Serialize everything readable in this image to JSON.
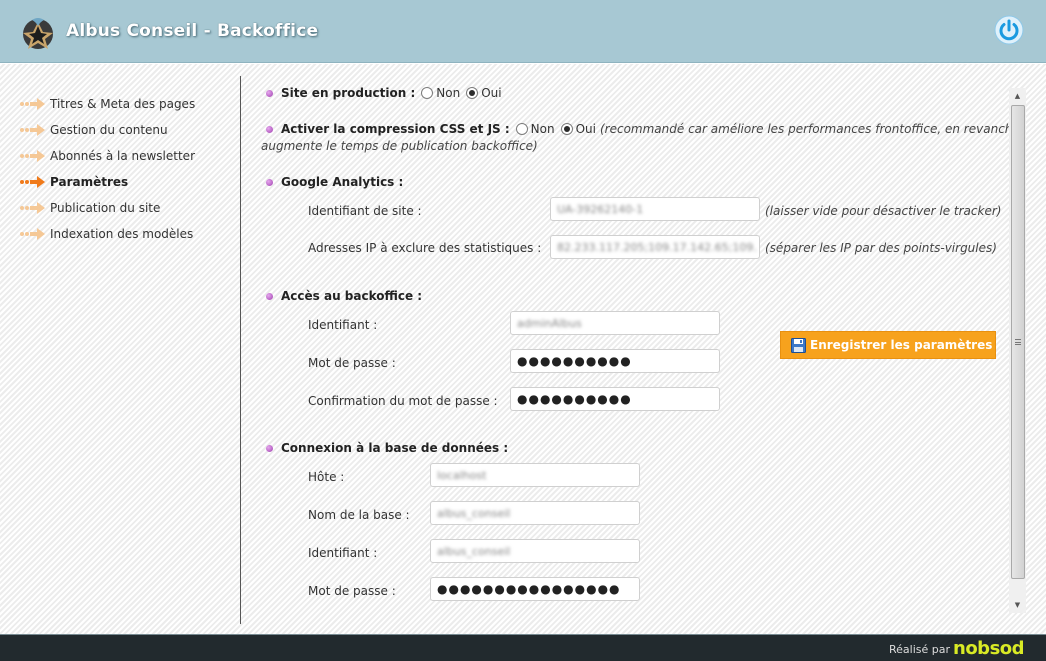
{
  "header": {
    "title": "Albus Conseil - Backoffice",
    "logo_icon": "albus-logo-icon",
    "power_icon": "power-icon"
  },
  "sidebar": {
    "items": [
      {
        "label": "Titres & Meta des pages",
        "active": false
      },
      {
        "label": "Gestion du contenu",
        "active": false
      },
      {
        "label": "Abonnés à la newsletter",
        "active": false
      },
      {
        "label": "Paramètres",
        "active": true
      },
      {
        "label": "Publication du site",
        "active": false
      },
      {
        "label": "Indexation des modèles",
        "active": false
      }
    ]
  },
  "main": {
    "production": {
      "title": "Site en production :",
      "opt_no": "Non",
      "opt_yes": "Oui",
      "selected": "Oui"
    },
    "compression": {
      "title": "Activer la compression CSS et JS :",
      "opt_no": "Non",
      "opt_yes": "Oui",
      "selected": "Oui",
      "note_line1": "(recommandé car améliore les performances frontoffice, en revanche",
      "note_line2": "augmente le temps de publication backoffice)"
    },
    "analytics": {
      "title": "Google Analytics :",
      "site_id_label": "Identifiant de site :",
      "site_id_value": "UA-39262140-1",
      "site_id_hint": "(laisser vide pour désactiver le tracker)",
      "ip_label": "Adresses IP à exclure des statistiques :",
      "ip_value": "82.233.117.205;109.17.142.65;109.",
      "ip_hint": "(séparer les IP par des points-virgules)"
    },
    "backoffice": {
      "title": "Accès au backoffice :",
      "login_label": "Identifiant :",
      "login_value": "adminAlbus",
      "pwd_label": "Mot de passe :",
      "pwd_value": "●●●●●●●●●●",
      "confirm_label": "Confirmation du mot de passe :",
      "confirm_value": "●●●●●●●●●●"
    },
    "database": {
      "title": "Connexion à la base de données :",
      "host_label": "Hôte :",
      "host_value": "localhost",
      "dbname_label": "Nom de la base :",
      "dbname_value": "albus_conseil",
      "user_label": "Identifiant :",
      "user_value": "albus_conseil",
      "pwd_label": "Mot de passe :",
      "pwd_value": "●●●●●●●●●●●●●●●●"
    },
    "save_button": "Enregistrer les paramètres",
    "save_icon": "floppy-disk-icon"
  },
  "footer": {
    "credit": "Réalisé par",
    "brand": "nobsod"
  },
  "colors": {
    "header_bg": "#a7c8d3",
    "accent_orange": "#f7a21d",
    "bullet_purple": "#a040b0",
    "footer_bg": "#222a2e",
    "brand_yellow": "#d9ea25"
  }
}
